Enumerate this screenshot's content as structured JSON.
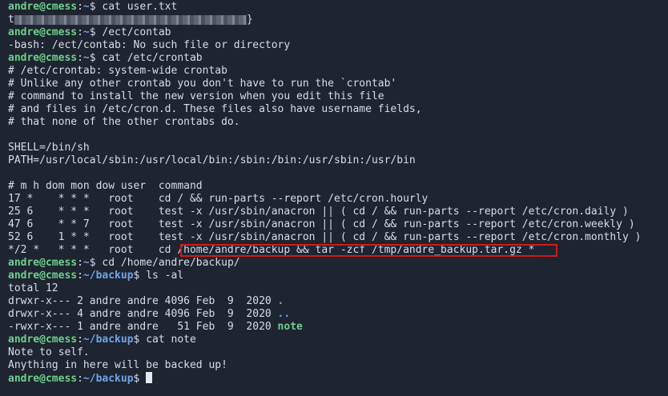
{
  "prompt": {
    "user": "andre@cmess",
    "sep": ":",
    "home": "~",
    "backup": "~/backup",
    "sym": "$ "
  },
  "lines": {
    "l1_cmd": "cat user.txt",
    "l2_prefix": "t",
    "l2_suffix": "}",
    "l3_cmd": "/ect/contab",
    "l4": "-bash: /ect/contab: No such file or directory",
    "l5_cmd": "cat /etc/crontab",
    "l6": "# /etc/crontab: system-wide crontab",
    "l7": "# Unlike any other crontab you don't have to run the `crontab'",
    "l8": "# command to install the new version when you edit this file",
    "l9": "# and files in /etc/cron.d. These files also have username fields,",
    "l10": "# that none of the other crontabs do.",
    "l12": "SHELL=/bin/sh",
    "l13": "PATH=/usr/local/sbin:/usr/local/bin:/sbin:/bin:/usr/sbin:/usr/bin",
    "l15": "# m h dom mon dow user  command",
    "l16": "17 *    * * *   root    cd / && run-parts --report /etc/cron.hourly",
    "l17": "25 6    * * *   root    test -x /usr/sbin/anacron || ( cd / && run-parts --report /etc/cron.daily )",
    "l18": "47 6    * * 7   root    test -x /usr/sbin/anacron || ( cd / && run-parts --report /etc/cron.weekly )",
    "l19": "52 6    1 * *   root    test -x /usr/sbin/anacron || ( cd / && run-parts --report /etc/cron.monthly )",
    "l20": "*/2 *   * * *   root    cd /home/andre/backup && tar -zcf /tmp/andre_backup.tar.gz *",
    "l21_cmd": "cd /home/andre/backup/",
    "l22_cmd": "ls -al",
    "l23": "total 12",
    "l24_meta": "drwxr-x--- 2 andre andre 4096 Feb  9  2020 ",
    "l24_name": ".",
    "l25_meta": "drwxr-x--- 4 andre andre 4096 Feb  9  2020 ",
    "l25_name": "..",
    "l26_meta": "-rwxr-x--- 1 andre andre   51 Feb  9  2020 ",
    "l26_name": "note",
    "l27_cmd": "cat note",
    "l28": "Note to self.",
    "l29": "Anything in here will be backed up!"
  },
  "colors": {
    "background": "#1e2430",
    "prompt_user": "#6fd08c",
    "prompt_path": "#6fa4e8",
    "highlight_border": "#d11a1a"
  }
}
